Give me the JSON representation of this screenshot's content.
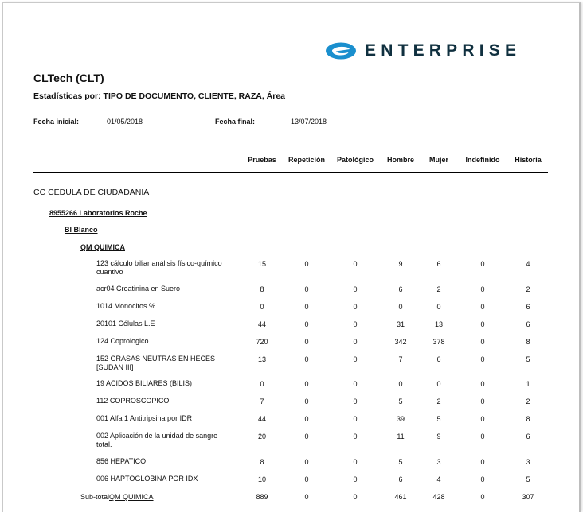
{
  "brand": {
    "name": "ENTERPRISE",
    "colors": {
      "logo": "#1a8fce",
      "text": "#10303f"
    }
  },
  "report": {
    "title": "CLTech (CLT)",
    "subtitle": "Estadísticas por: TIPO DE DOCUMENTO, CLIENTE, RAZA, Área",
    "fecha_inicial_label": "Fecha inicial:",
    "fecha_inicial": "01/05/2018",
    "fecha_final_label": "Fecha final:",
    "fecha_final": "13/07/2018"
  },
  "columns": [
    "Pruebas",
    "Repetición",
    "Patológico",
    "Hombre",
    "Mujer",
    "Indefinido",
    "Historia"
  ],
  "groups": {
    "documento": "CC CEDULA DE CIUDADANIA",
    "cliente": "8955266 Laboratorios Roche",
    "raza": "Bl Blanco",
    "area": "QM QUIMICA"
  },
  "rows": [
    {
      "name": "123 cálculo biliar análisis físico-químico cuantivo",
      "values": [
        "15",
        "0",
        "0",
        "9",
        "6",
        "0",
        "4"
      ]
    },
    {
      "name": "acr04 Creatinina en Suero",
      "values": [
        "8",
        "0",
        "0",
        "6",
        "2",
        "0",
        "2"
      ]
    },
    {
      "name": "1014 Monocitos %",
      "values": [
        "0",
        "0",
        "0",
        "0",
        "0",
        "0",
        "6"
      ]
    },
    {
      "name": "20101 Células L.E",
      "values": [
        "44",
        "0",
        "0",
        "31",
        "13",
        "0",
        "6"
      ]
    },
    {
      "name": "124 Coprologico",
      "values": [
        "720",
        "0",
        "0",
        "342",
        "378",
        "0",
        "8"
      ]
    },
    {
      "name": "152 GRASAS NEUTRAS EN HECES [SUDAN III]",
      "values": [
        "13",
        "0",
        "0",
        "7",
        "6",
        "0",
        "5"
      ]
    },
    {
      "name": "19 ACIDOS BILIARES (BILIS)",
      "values": [
        "0",
        "0",
        "0",
        "0",
        "0",
        "0",
        "1"
      ]
    },
    {
      "name": "112 COPROSCOPICO",
      "values": [
        "7",
        "0",
        "0",
        "5",
        "2",
        "0",
        "2"
      ]
    },
    {
      "name": "001 Alfa 1 Antitripsina por IDR",
      "values": [
        "44",
        "0",
        "0",
        "39",
        "5",
        "0",
        "8"
      ]
    },
    {
      "name": "002 Aplicación de la unidad de sangre total.",
      "values": [
        "20",
        "0",
        "0",
        "11",
        "9",
        "0",
        "6"
      ]
    },
    {
      "name": "856 HEPATICO",
      "values": [
        "8",
        "0",
        "0",
        "5",
        "3",
        "0",
        "3"
      ]
    },
    {
      "name": "006 HAPTOGLOBINA POR IDX",
      "values": [
        "10",
        "0",
        "0",
        "6",
        "4",
        "0",
        "5"
      ]
    }
  ],
  "subtotal": {
    "label": "Sub-total",
    "area": "QM QUIMICA",
    "values": [
      "889",
      "0",
      "0",
      "461",
      "428",
      "0",
      "307"
    ]
  }
}
